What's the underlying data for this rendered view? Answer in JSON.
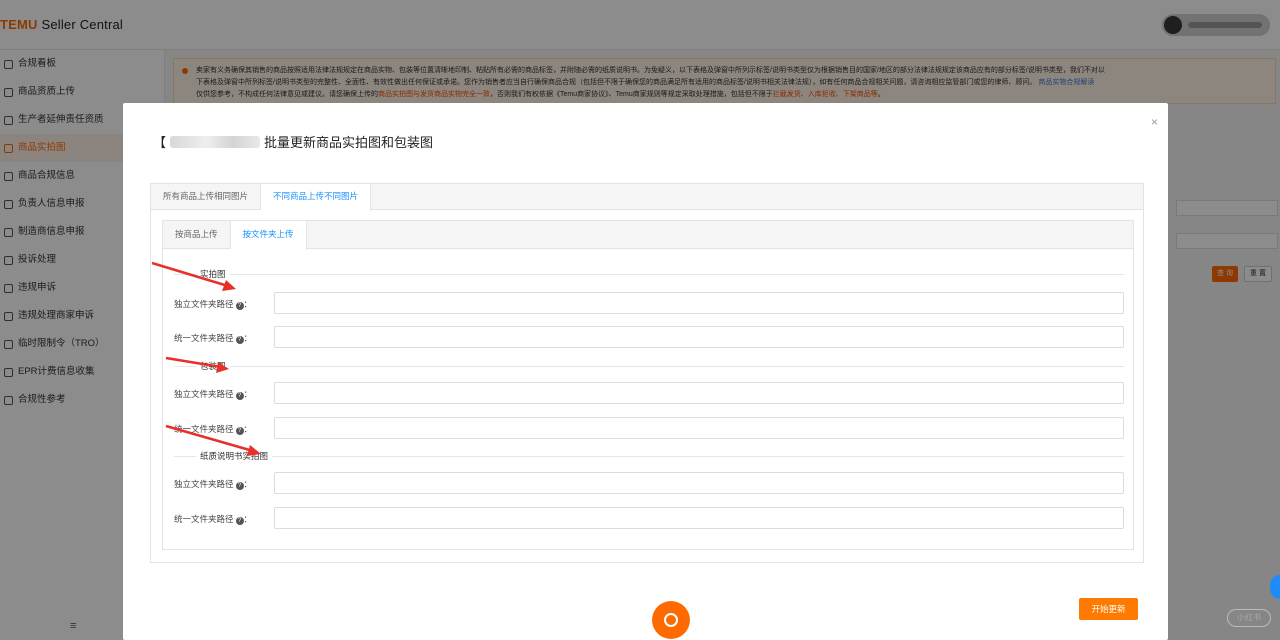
{
  "header": {
    "brand": "TEMU",
    "app_name": " Seller Central"
  },
  "sidebar": {
    "items": [
      {
        "label": "合规看板",
        "active": false
      },
      {
        "label": "商品资质上传",
        "active": false
      },
      {
        "label": "生产者延伸责任资质",
        "active": false
      },
      {
        "label": "商品实拍图",
        "active": true
      },
      {
        "label": "商品合规信息",
        "active": false
      },
      {
        "label": "负责人信息申报",
        "active": false
      },
      {
        "label": "制造商信息申报",
        "active": false
      },
      {
        "label": "投诉处理",
        "active": false
      },
      {
        "label": "违规申诉",
        "active": false
      },
      {
        "label": "违规处理商家申诉",
        "active": false
      },
      {
        "label": "临时限制令（TRO）",
        "active": false
      },
      {
        "label": "EPR计费信息收集",
        "active": false
      },
      {
        "label": "合规性参考",
        "active": false
      }
    ],
    "collapse_glyph": "≡"
  },
  "notice": {
    "line1": "卖家有义务确保其销售的商品按照适用法律法规规定在商品实物、包装等位置清晰地印制、粘贴所有必需的商品标签，并附随必需的纸质说明书。为免疑义，以下表格及弹窗中所列示标签/说明书类型仅为根据销售目的国家/地区的部分法律法规规定该商品应有的部分标签/说明书类型，我们不对以",
    "line2_a": "下表格及弹窗中所列标签/说明书类型的完整性、全面性、有效性做出任何保证或承诺。您作为销售者应当自行确保商品合规（包括但不限于确保您的商品满足所有适用的商品标签/说明书相关法律法规），如有任何商品合规相关问题，请咨询相应监管部门或您的律师、顾问。",
    "line2_link": "商品实物合规解读",
    "line3_a": "仅供您参考，不构成任何法律意见或建议。请您确保上传的",
    "line3_hl": "商品实拍图与发货商品实物完全一致",
    "line3_b": "，否则我们有权依据《Temu商家协议》、Temu商家规则等规定采取处理措施，包括但不限于",
    "line3_hl2": "拦截发货、入库拒收、下架商品等",
    "line3_end": "。"
  },
  "background": {
    "query_button": "查 询",
    "reset_button": "重 置"
  },
  "modal": {
    "title_prefix": "【",
    "title": "批量更新商品实拍图和包装图",
    "close_glyph": "×",
    "outer_tabs": [
      {
        "label": "所有商品上传相同图片",
        "active": false
      },
      {
        "label": "不同商品上传不同图片",
        "active": true
      }
    ],
    "inner_tabs": [
      {
        "label": "按商品上传",
        "active": false
      },
      {
        "label": "按文件夹上传",
        "active": true
      }
    ],
    "sections": [
      {
        "title": "实拍图",
        "fields": [
          {
            "label": "独立文件夹路径",
            "suffix": "：",
            "value": ""
          },
          {
            "label": "统一文件夹路径",
            "suffix": "：",
            "value": ""
          }
        ]
      },
      {
        "title": "包装图",
        "fields": [
          {
            "label": "独立文件夹路径",
            "suffix": "：",
            "value": ""
          },
          {
            "label": "统一文件夹路径",
            "suffix": "：",
            "value": ""
          }
        ]
      },
      {
        "title": "纸质说明书实拍图",
        "fields": [
          {
            "label": "独立文件夹路径",
            "suffix": "：",
            "value": ""
          },
          {
            "label": "统一文件夹路径",
            "suffix": "：",
            "value": ""
          }
        ]
      }
    ],
    "help_glyph": "?",
    "start_button": "开始更新"
  },
  "corner_tag": "小红书",
  "colors": {
    "brand_orange": "#ff6a00",
    "tab_active_blue": "#1890ff",
    "arrow_red": "#e8302a"
  }
}
